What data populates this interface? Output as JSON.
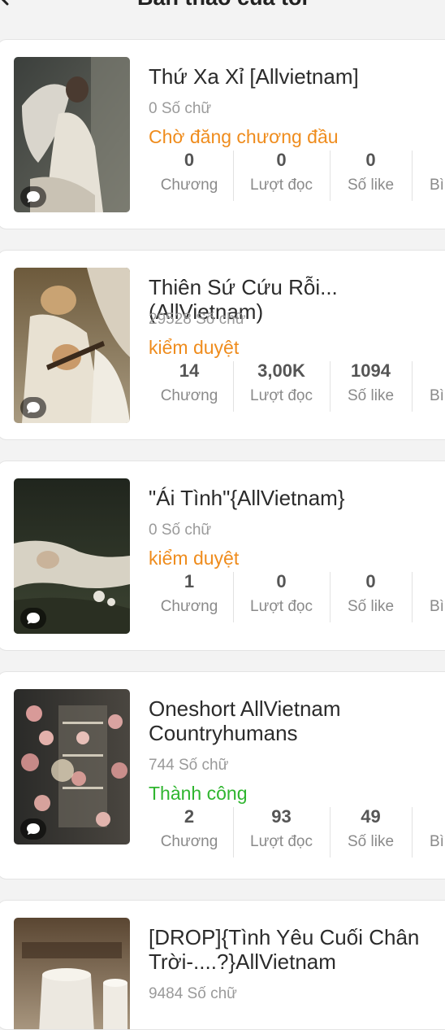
{
  "header": {
    "title": "Bản thảo của tôi"
  },
  "colors": {
    "pending": "#ef8c1d",
    "review": "#ef8c1d",
    "success": "#2fb52f"
  },
  "books": [
    {
      "title": "Thứ Xa Xỉ [Allvietnam]",
      "word_count": "0 Số chữ",
      "status": "Chờ đăng chương đầu",
      "status_kind": "pending",
      "stats": [
        {
          "value": "0",
          "label": "Chương"
        },
        {
          "value": "0",
          "label": "Lượt đọc"
        },
        {
          "value": "0",
          "label": "Số like"
        },
        {
          "value": "",
          "label": "Bì"
        }
      ]
    },
    {
      "title": "Thiên Sứ Cứu Rỗi...(AllVietnam)",
      "word_count": "29528 Số chữ",
      "status": "kiểm duyệt",
      "status_kind": "review",
      "stats": [
        {
          "value": "14",
          "label": "Chương"
        },
        {
          "value": "3,00K",
          "label": "Lượt đọc"
        },
        {
          "value": "1094",
          "label": "Số like"
        },
        {
          "value": "",
          "label": "Bì"
        }
      ]
    },
    {
      "title": "\"Ái Tình\"{AllVietnam}",
      "word_count": "0 Số chữ",
      "status": "kiểm duyệt",
      "status_kind": "review",
      "stats": [
        {
          "value": "1",
          "label": "Chương"
        },
        {
          "value": "0",
          "label": "Lượt đọc"
        },
        {
          "value": "0",
          "label": "Số like"
        },
        {
          "value": "",
          "label": "Bì"
        }
      ]
    },
    {
      "title": "Oneshort AllVietnam\nCountryhumans",
      "word_count": "744 Số chữ",
      "status": "Thành công",
      "status_kind": "success",
      "stats": [
        {
          "value": "2",
          "label": "Chương"
        },
        {
          "value": "93",
          "label": "Lượt đọc"
        },
        {
          "value": "49",
          "label": "Số like"
        },
        {
          "value": "",
          "label": "Bì"
        }
      ]
    },
    {
      "title": "[DROP]{Tình Yêu Cuối Chân\nTrời-....?}AllVietnam",
      "word_count": "9484 Số chữ",
      "status": "",
      "status_kind": "",
      "stats": []
    }
  ]
}
